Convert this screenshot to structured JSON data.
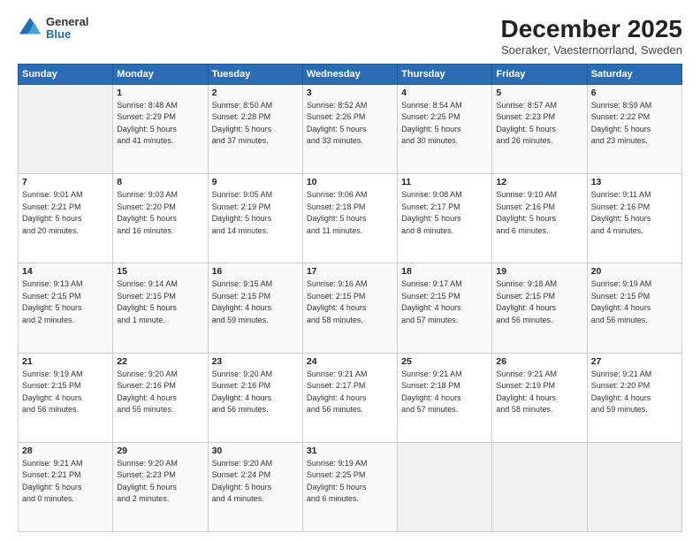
{
  "header": {
    "title": "December 2025",
    "subtitle": "Soeraker, Vaesternorrland, Sweden"
  },
  "logo": {
    "general": "General",
    "blue": "Blue"
  },
  "days_of_week": [
    "Sunday",
    "Monday",
    "Tuesday",
    "Wednesday",
    "Thursday",
    "Friday",
    "Saturday"
  ],
  "weeks": [
    [
      {
        "day": "",
        "info": ""
      },
      {
        "day": "1",
        "info": "Sunrise: 8:48 AM\nSunset: 2:29 PM\nDaylight: 5 hours\nand 41 minutes."
      },
      {
        "day": "2",
        "info": "Sunrise: 8:50 AM\nSunset: 2:28 PM\nDaylight: 5 hours\nand 37 minutes."
      },
      {
        "day": "3",
        "info": "Sunrise: 8:52 AM\nSunset: 2:26 PM\nDaylight: 5 hours\nand 33 minutes."
      },
      {
        "day": "4",
        "info": "Sunrise: 8:54 AM\nSunset: 2:25 PM\nDaylight: 5 hours\nand 30 minutes."
      },
      {
        "day": "5",
        "info": "Sunrise: 8:57 AM\nSunset: 2:23 PM\nDaylight: 5 hours\nand 26 minutes."
      },
      {
        "day": "6",
        "info": "Sunrise: 8:59 AM\nSunset: 2:22 PM\nDaylight: 5 hours\nand 23 minutes."
      }
    ],
    [
      {
        "day": "7",
        "info": "Sunrise: 9:01 AM\nSunset: 2:21 PM\nDaylight: 5 hours\nand 20 minutes."
      },
      {
        "day": "8",
        "info": "Sunrise: 9:03 AM\nSunset: 2:20 PM\nDaylight: 5 hours\nand 16 minutes."
      },
      {
        "day": "9",
        "info": "Sunrise: 9:05 AM\nSunset: 2:19 PM\nDaylight: 5 hours\nand 14 minutes."
      },
      {
        "day": "10",
        "info": "Sunrise: 9:06 AM\nSunset: 2:18 PM\nDaylight: 5 hours\nand 11 minutes."
      },
      {
        "day": "11",
        "info": "Sunrise: 9:08 AM\nSunset: 2:17 PM\nDaylight: 5 hours\nand 8 minutes."
      },
      {
        "day": "12",
        "info": "Sunrise: 9:10 AM\nSunset: 2:16 PM\nDaylight: 5 hours\nand 6 minutes."
      },
      {
        "day": "13",
        "info": "Sunrise: 9:11 AM\nSunset: 2:16 PM\nDaylight: 5 hours\nand 4 minutes."
      }
    ],
    [
      {
        "day": "14",
        "info": "Sunrise: 9:13 AM\nSunset: 2:15 PM\nDaylight: 5 hours\nand 2 minutes."
      },
      {
        "day": "15",
        "info": "Sunrise: 9:14 AM\nSunset: 2:15 PM\nDaylight: 5 hours\nand 1 minute."
      },
      {
        "day": "16",
        "info": "Sunrise: 9:15 AM\nSunset: 2:15 PM\nDaylight: 4 hours\nand 59 minutes."
      },
      {
        "day": "17",
        "info": "Sunrise: 9:16 AM\nSunset: 2:15 PM\nDaylight: 4 hours\nand 58 minutes."
      },
      {
        "day": "18",
        "info": "Sunrise: 9:17 AM\nSunset: 2:15 PM\nDaylight: 4 hours\nand 57 minutes."
      },
      {
        "day": "19",
        "info": "Sunrise: 9:18 AM\nSunset: 2:15 PM\nDaylight: 4 hours\nand 56 minutes."
      },
      {
        "day": "20",
        "info": "Sunrise: 9:19 AM\nSunset: 2:15 PM\nDaylight: 4 hours\nand 56 minutes."
      }
    ],
    [
      {
        "day": "21",
        "info": "Sunrise: 9:19 AM\nSunset: 2:15 PM\nDaylight: 4 hours\nand 56 minutes."
      },
      {
        "day": "22",
        "info": "Sunrise: 9:20 AM\nSunset: 2:16 PM\nDaylight: 4 hours\nand 55 minutes."
      },
      {
        "day": "23",
        "info": "Sunrise: 9:20 AM\nSunset: 2:16 PM\nDaylight: 4 hours\nand 56 minutes."
      },
      {
        "day": "24",
        "info": "Sunrise: 9:21 AM\nSunset: 2:17 PM\nDaylight: 4 hours\nand 56 minutes."
      },
      {
        "day": "25",
        "info": "Sunrise: 9:21 AM\nSunset: 2:18 PM\nDaylight: 4 hours\nand 57 minutes."
      },
      {
        "day": "26",
        "info": "Sunrise: 9:21 AM\nSunset: 2:19 PM\nDaylight: 4 hours\nand 58 minutes."
      },
      {
        "day": "27",
        "info": "Sunrise: 9:21 AM\nSunset: 2:20 PM\nDaylight: 4 hours\nand 59 minutes."
      }
    ],
    [
      {
        "day": "28",
        "info": "Sunrise: 9:21 AM\nSunset: 2:21 PM\nDaylight: 5 hours\nand 0 minutes."
      },
      {
        "day": "29",
        "info": "Sunrise: 9:20 AM\nSunset: 2:23 PM\nDaylight: 5 hours\nand 2 minutes."
      },
      {
        "day": "30",
        "info": "Sunrise: 9:20 AM\nSunset: 2:24 PM\nDaylight: 5 hours\nand 4 minutes."
      },
      {
        "day": "31",
        "info": "Sunrise: 9:19 AM\nSunset: 2:25 PM\nDaylight: 5 hours\nand 6 minutes."
      },
      {
        "day": "",
        "info": ""
      },
      {
        "day": "",
        "info": ""
      },
      {
        "day": "",
        "info": ""
      }
    ]
  ]
}
